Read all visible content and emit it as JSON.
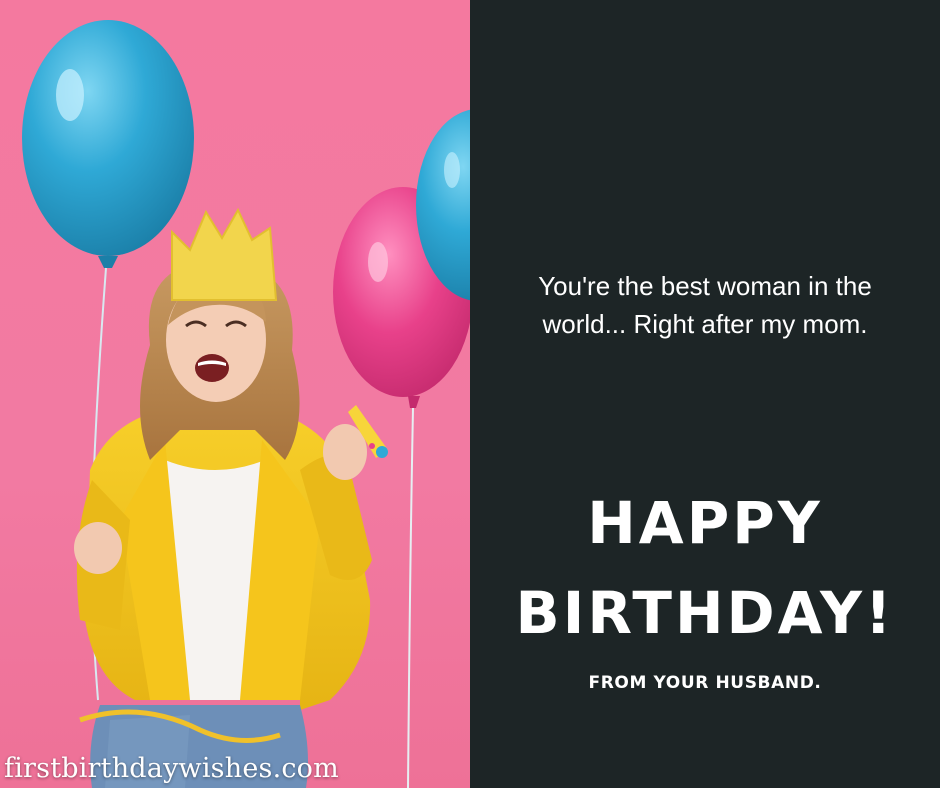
{
  "card": {
    "quote_line1": "You're the best woman in the",
    "quote_line2": "world... Right after my mom.",
    "headline_line1": "HAPPY",
    "headline_line2": "BIRTHDAY!",
    "signature": "FROM YOUR HUSBAND.",
    "watermark": "firstbirthdaywishes.com"
  },
  "colors": {
    "photo_background": "#f4799f",
    "panel_background": "#1d2526",
    "text": "#ffffff",
    "blue_balloon": "#2fa9d6",
    "pink_balloon": "#e8418a",
    "jacket": "#f5c51c",
    "crown": "#f2d54c"
  },
  "icons": [
    "blue-balloon-icon",
    "pink-balloon-icon",
    "crown-icon",
    "party-horn-icon"
  ]
}
